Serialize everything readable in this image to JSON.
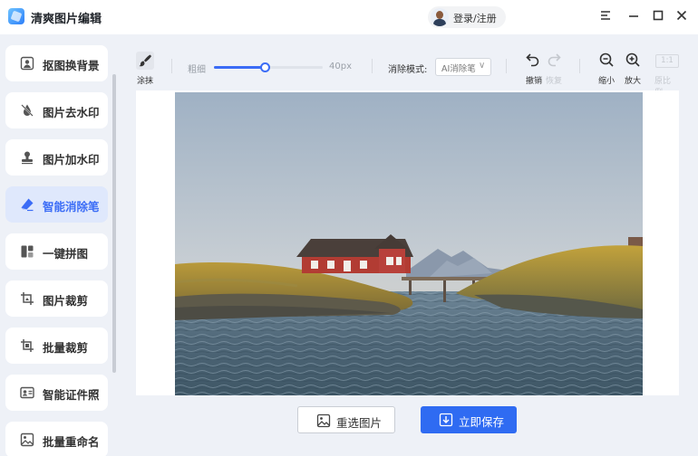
{
  "app": {
    "title": "清爽图片编辑",
    "login_label": "登录/注册"
  },
  "window_controls": {
    "menu_icon": "menu-icon",
    "minimize_icon": "minimize-icon",
    "maximize_icon": "maximize-icon",
    "close_icon": "close-icon"
  },
  "sidebar": {
    "items": [
      {
        "label": "抠图换背景",
        "icon": "cutout-icon"
      },
      {
        "label": "图片去水印",
        "icon": "watermark-remove-icon"
      },
      {
        "label": "图片加水印",
        "icon": "stamp-icon"
      },
      {
        "label": "智能消除笔",
        "icon": "eraser-icon",
        "active": true
      },
      {
        "label": "一键拼图",
        "icon": "collage-icon"
      },
      {
        "label": "图片裁剪",
        "icon": "crop-icon"
      },
      {
        "label": "批量裁剪",
        "icon": "batch-crop-icon"
      },
      {
        "label": "智能证件照",
        "icon": "id-photo-icon"
      },
      {
        "label": "批量重命名",
        "icon": "rename-icon"
      }
    ]
  },
  "toolbar": {
    "eraser_label": "涂抹",
    "size_label": "粗细",
    "size_value": "40px",
    "size_fraction": 0.47,
    "mode_label": "消除模式:",
    "mode_value": "AI消除笔",
    "undo_label": "撤销",
    "redo_label": "恢复",
    "zoom_out_label": "缩小",
    "zoom_in_label": "放大",
    "ratio_value": "1:1",
    "ratio_label": "原比例"
  },
  "actions": {
    "reselect_label": "重选图片",
    "save_label": "立即保存"
  },
  "colors": {
    "accent": "#3b6cf6",
    "save_button": "#2f6bf2",
    "sidebar_bg": "#eef1f7",
    "active_item_bg": "#dfe8fc"
  }
}
